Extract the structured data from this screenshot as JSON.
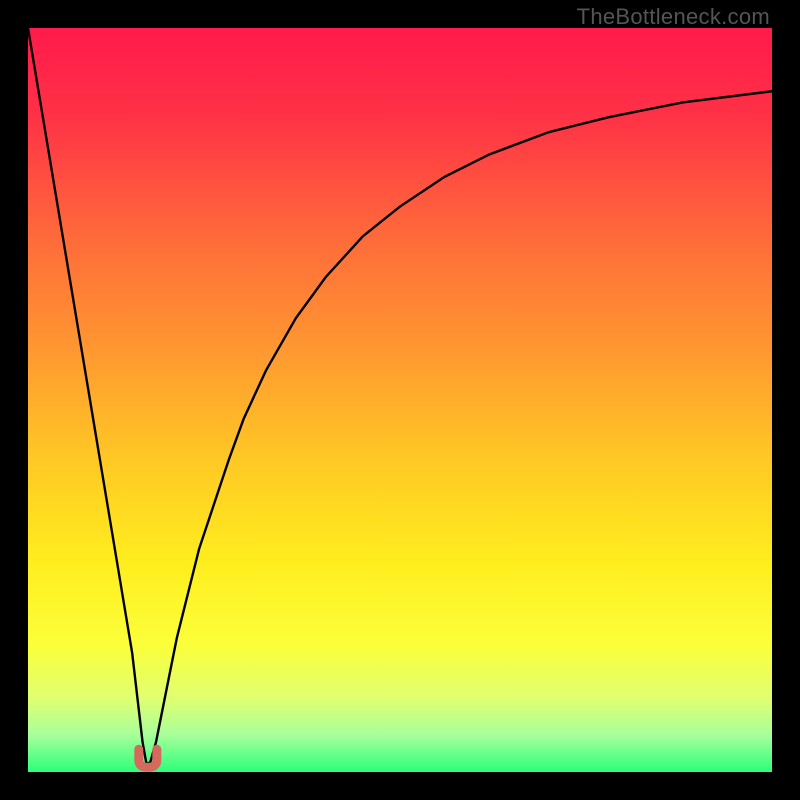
{
  "watermark": {
    "text": "TheBottleneck.com"
  },
  "chart_data": {
    "type": "line",
    "title": "",
    "xlabel": "",
    "ylabel": "",
    "xlim": [
      0,
      100
    ],
    "ylim": [
      0,
      100
    ],
    "grid": false,
    "background": {
      "gradient": "vertical",
      "stops": [
        {
          "offset": 0.0,
          "color": "#ff1a4b"
        },
        {
          "offset": 0.12,
          "color": "#ff3246"
        },
        {
          "offset": 0.28,
          "color": "#ff6a3a"
        },
        {
          "offset": 0.44,
          "color": "#ff9a30"
        },
        {
          "offset": 0.58,
          "color": "#ffc824"
        },
        {
          "offset": 0.72,
          "color": "#ffee1e"
        },
        {
          "offset": 0.83,
          "color": "#fbff3a"
        },
        {
          "offset": 0.9,
          "color": "#e0ff70"
        },
        {
          "offset": 0.95,
          "color": "#a8ff9a"
        },
        {
          "offset": 1.0,
          "color": "#2bff7a"
        }
      ]
    },
    "series": [
      {
        "name": "bottleneck-curve",
        "color": "#000000",
        "x": [
          0.0,
          2.0,
          4.0,
          6.0,
          8.0,
          10.0,
          12.0,
          14.0,
          15.4,
          15.9,
          16.4,
          17.2,
          18.0,
          19.0,
          20.0,
          21.5,
          23.0,
          25.0,
          27.0,
          29.0,
          32.0,
          36.0,
          40.0,
          45.0,
          50.0,
          56.0,
          62.0,
          70.0,
          78.0,
          88.0,
          100.0
        ],
        "y": [
          100.0,
          88.0,
          76.0,
          64.0,
          52.0,
          40.0,
          28.0,
          16.0,
          4.0,
          1.2,
          1.2,
          4.0,
          8.0,
          13.0,
          18.0,
          24.0,
          30.0,
          36.0,
          42.0,
          47.5,
          54.0,
          61.0,
          66.5,
          72.0,
          76.0,
          80.0,
          83.0,
          86.0,
          88.0,
          90.0,
          91.5
        ]
      }
    ],
    "marker": {
      "name": "optimal-point",
      "x": 16.1,
      "y": 1.3,
      "color": "#d46a5e",
      "shape": "u"
    }
  }
}
